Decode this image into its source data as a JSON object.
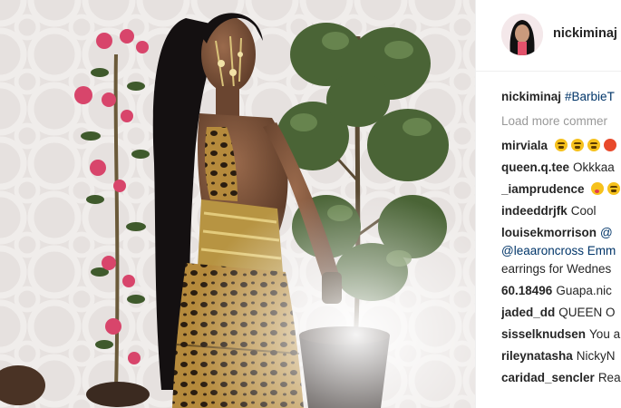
{
  "post": {
    "username": "nickiminaj",
    "caption_user": "nickiminaj",
    "caption_tag": "#BarbieT",
    "load_more": "Load more commer"
  },
  "comments": [
    {
      "user": "mirviala",
      "text": "",
      "emojis": [
        "y",
        "y",
        "y",
        "r"
      ]
    },
    {
      "user": "queen.q.tee",
      "text": "Okkkaa"
    },
    {
      "user": "_iamprudence",
      "text": "",
      "emojis": [
        "k",
        "y"
      ]
    },
    {
      "user": "indeeddrjfk",
      "text": "Cool"
    },
    {
      "user": "louisekmorrison",
      "text": "@",
      "line2": "@leaaroncross Emm",
      "line3": "earrings for Wednes"
    },
    {
      "user": "60.18496",
      "text": "Guapa.nic"
    },
    {
      "user": "jaded_dd",
      "text": "QUEEN O"
    },
    {
      "user": "sisselknudsen",
      "text": "You a"
    },
    {
      "user": "rileynatasha",
      "text": "NickyN"
    },
    {
      "user": "caridad_sencler",
      "text": "Rea"
    }
  ],
  "colors": {
    "link": "#003569",
    "muted": "#999999",
    "text": "#262626"
  }
}
